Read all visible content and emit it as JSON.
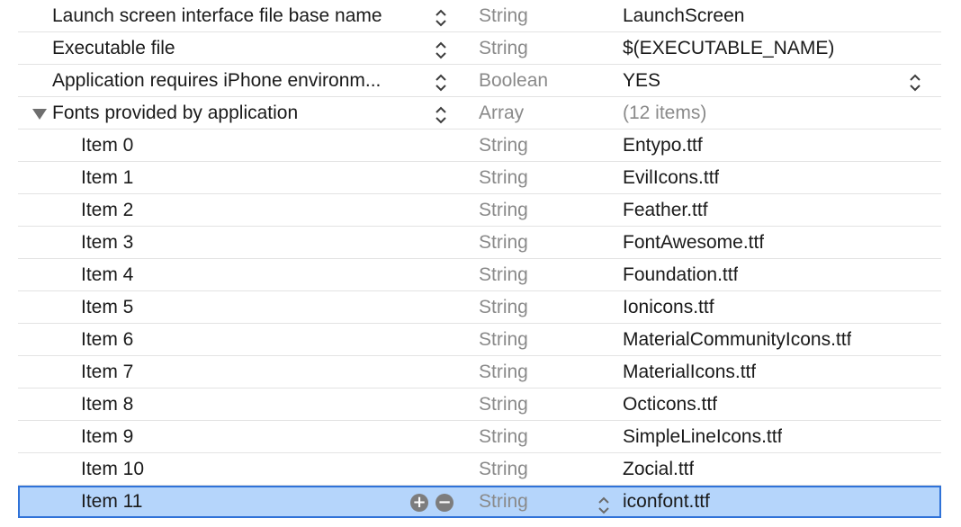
{
  "rows": [
    {
      "key": "Launch screen interface file base name",
      "type": "String",
      "value": "LaunchScreen"
    },
    {
      "key": "Executable file",
      "type": "String",
      "value": "$(EXECUTABLE_NAME)"
    },
    {
      "key": "Application requires iPhone environm...",
      "type": "Boolean",
      "value": "YES"
    },
    {
      "key": "Fonts provided by application",
      "type": "Array",
      "value": "(12 items)"
    },
    {
      "key": "Item 0",
      "type": "String",
      "value": "Entypo.ttf"
    },
    {
      "key": "Item 1",
      "type": "String",
      "value": "EvilIcons.ttf"
    },
    {
      "key": "Item 2",
      "type": "String",
      "value": "Feather.ttf"
    },
    {
      "key": "Item 3",
      "type": "String",
      "value": "FontAwesome.ttf"
    },
    {
      "key": "Item 4",
      "type": "String",
      "value": "Foundation.ttf"
    },
    {
      "key": "Item 5",
      "type": "String",
      "value": "Ionicons.ttf"
    },
    {
      "key": "Item 6",
      "type": "String",
      "value": "MaterialCommunityIcons.ttf"
    },
    {
      "key": "Item 7",
      "type": "String",
      "value": "MaterialIcons.ttf"
    },
    {
      "key": "Item 8",
      "type": "String",
      "value": "Octicons.ttf"
    },
    {
      "key": "Item 9",
      "type": "String",
      "value": "SimpleLineIcons.ttf"
    },
    {
      "key": "Item 10",
      "type": "String",
      "value": "Zocial.ttf"
    },
    {
      "key": "Item 11",
      "type": "String",
      "value": "iconfont.ttf"
    }
  ],
  "icons": {
    "stepper": "up-down-chevron-icon",
    "disclosure": "disclosure-triangle-down-icon",
    "add": "plus-circle-icon",
    "remove": "minus-circle-icon"
  },
  "colors": {
    "selection_fill": "#b5d5fb",
    "selection_border": "#2f72d8",
    "type_text": "#8a8a8a",
    "key_text": "#1a1a1a"
  }
}
